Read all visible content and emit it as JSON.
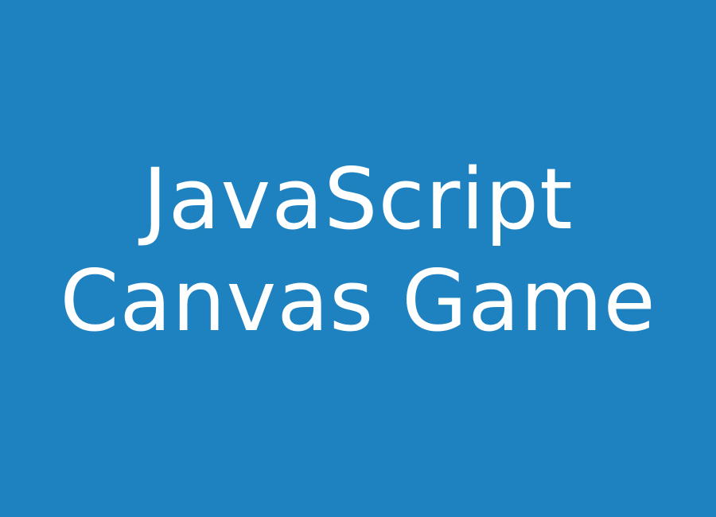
{
  "cover": {
    "background_color": "#1e82c1",
    "text_color": "#ffffff",
    "title_lines": [
      "JavaScript",
      "Canvas Game"
    ]
  }
}
